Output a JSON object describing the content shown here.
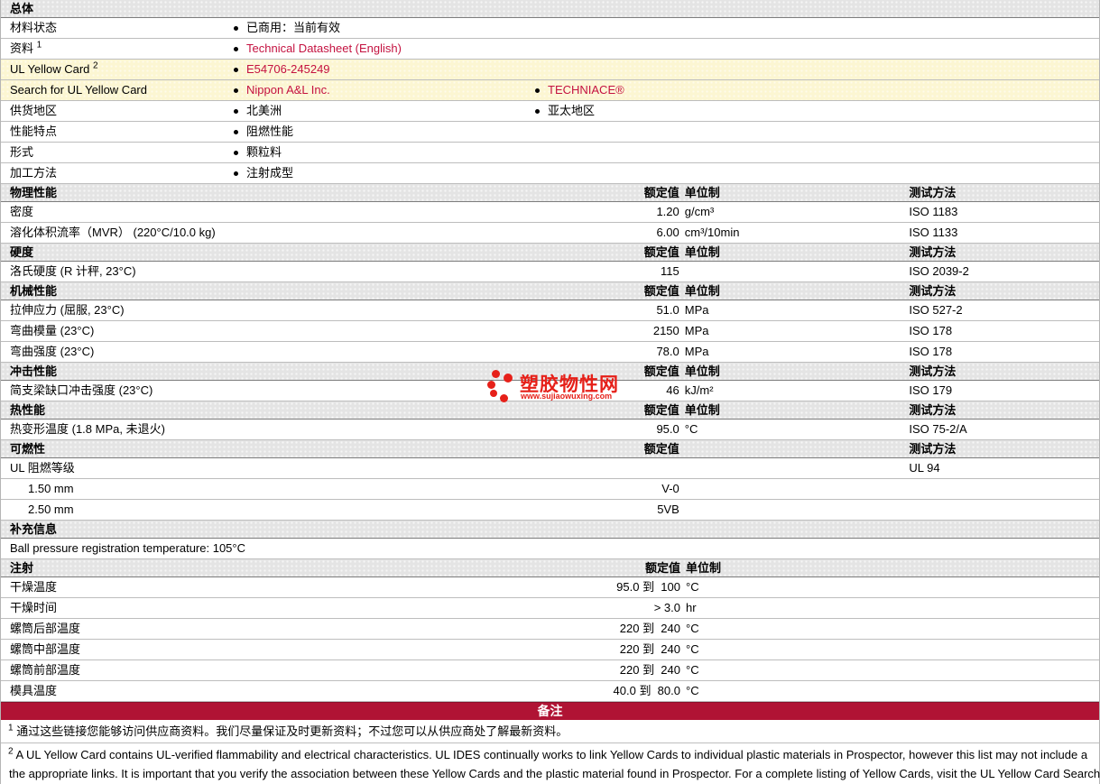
{
  "colors": {
    "section_header_bg": "#e4e4e4",
    "highlight_row_bg": "#fcf6d2",
    "link_red": "#c41240",
    "remark_bar_bg": "#b01334",
    "row_border": "#bdbdbd",
    "logo_red": "#e62019"
  },
  "labels": {
    "rated": "额定值",
    "units": "单位制",
    "test": "测试方法"
  },
  "overview": {
    "title": "总体",
    "rows": [
      {
        "label": "材料状态",
        "item1": "已商用：当前有效"
      },
      {
        "label": "资料",
        "sup": "1",
        "item1": "Technical Datasheet (English)"
      },
      {
        "label": "UL Yellow Card",
        "sup": "2",
        "item1": "E54706-245249"
      },
      {
        "label": "Search for UL Yellow Card",
        "item1": "Nippon A&L Inc.",
        "item2": "TECHNIACE®"
      },
      {
        "label": "供货地区",
        "item1": "北美洲",
        "item2": "亚太地区"
      },
      {
        "label": "性能特点",
        "item1": "阻燃性能"
      },
      {
        "label": "形式",
        "item1": "颗粒料"
      },
      {
        "label": "加工方法",
        "item1": "注射成型"
      }
    ]
  },
  "physical": {
    "title": "物理性能",
    "rows": [
      {
        "label": "密度",
        "value": "1.20",
        "unit": "g/cm³",
        "test": "ISO 1183"
      },
      {
        "label": "溶化体积流率（MVR）  (220°C/10.0 kg)",
        "value": "6.00",
        "unit": "cm³/10min",
        "test": "ISO 1133"
      }
    ]
  },
  "hardness": {
    "title": "硬度",
    "rows": [
      {
        "label": "洛氏硬度  (R 计秤, 23°C)",
        "value": "115",
        "unit": "",
        "test": "ISO 2039-2"
      }
    ]
  },
  "mechanical": {
    "title": "机械性能",
    "rows": [
      {
        "label": "拉伸应力  (屈服, 23°C)",
        "value": "51.0",
        "unit": "MPa",
        "test": "ISO 527-2"
      },
      {
        "label": "弯曲模量  (23°C)",
        "value": "2150",
        "unit": "MPa",
        "test": "ISO 178"
      },
      {
        "label": "弯曲强度  (23°C)",
        "value": "78.0",
        "unit": "MPa",
        "test": "ISO 178"
      }
    ]
  },
  "impact": {
    "title": "冲击性能",
    "rows": [
      {
        "label": "简支梁缺口冲击强度  (23°C)",
        "value": "46",
        "unit": "kJ/m²",
        "test": "ISO 179"
      }
    ]
  },
  "thermal": {
    "title": "热性能",
    "rows": [
      {
        "label": "热变形温度  (1.8 MPa, 未退火)",
        "value": "95.0",
        "unit": "°C",
        "test": "ISO 75-2/A"
      }
    ]
  },
  "flammability": {
    "title": "可燃性",
    "rows": [
      {
        "label": "UL 阻燃等级",
        "value": "",
        "unit": "",
        "test": "UL 94"
      },
      {
        "label": "1.50 mm",
        "value": "V-0",
        "unit": "",
        "test": ""
      },
      {
        "label": "2.50 mm",
        "value": "5VB",
        "unit": "",
        "test": ""
      }
    ]
  },
  "supplemental": {
    "title": "补充信息",
    "rows": [
      {
        "label": "Ball pressure registration temperature: 105°C"
      }
    ]
  },
  "injection": {
    "title": "注射",
    "rows": [
      {
        "label": "干燥温度",
        "value": "95.0 到  100",
        "unit": "°C"
      },
      {
        "label": "干燥时间",
        "value": "> 3.0",
        "unit": "hr"
      },
      {
        "label": "螺筒后部温度",
        "value": "220 到  240",
        "unit": "°C"
      },
      {
        "label": "螺筒中部温度",
        "value": "220 到  240",
        "unit": "°C"
      },
      {
        "label": "螺筒前部温度",
        "value": "220 到  240",
        "unit": "°C"
      },
      {
        "label": "模具温度",
        "value": "40.0 到  80.0",
        "unit": "°C"
      }
    ]
  },
  "remark": {
    "title": "备注"
  },
  "footnotes": [
    {
      "sup": "1",
      "text": "通过这些链接您能够访问供应商资料。我们尽量保证及时更新资料；不过您可以从供应商处了解最新资料。"
    },
    {
      "sup": "2",
      "line1": "A UL Yellow Card contains UL-verified flammability and electrical characteristics. UL IDES continually works to link Yellow Cards to individual plastic materials in Prospector, however this list may not include a",
      "line2": "the appropriate links. It is important that you verify the association between these Yellow Cards and the plastic material found in Prospector. For a complete listing of Yellow Cards, visit the UL Yellow Card Search"
    }
  ],
  "watermark": {
    "name": "塑胶物性网",
    "url": "www.sujiaowuxing.com"
  }
}
